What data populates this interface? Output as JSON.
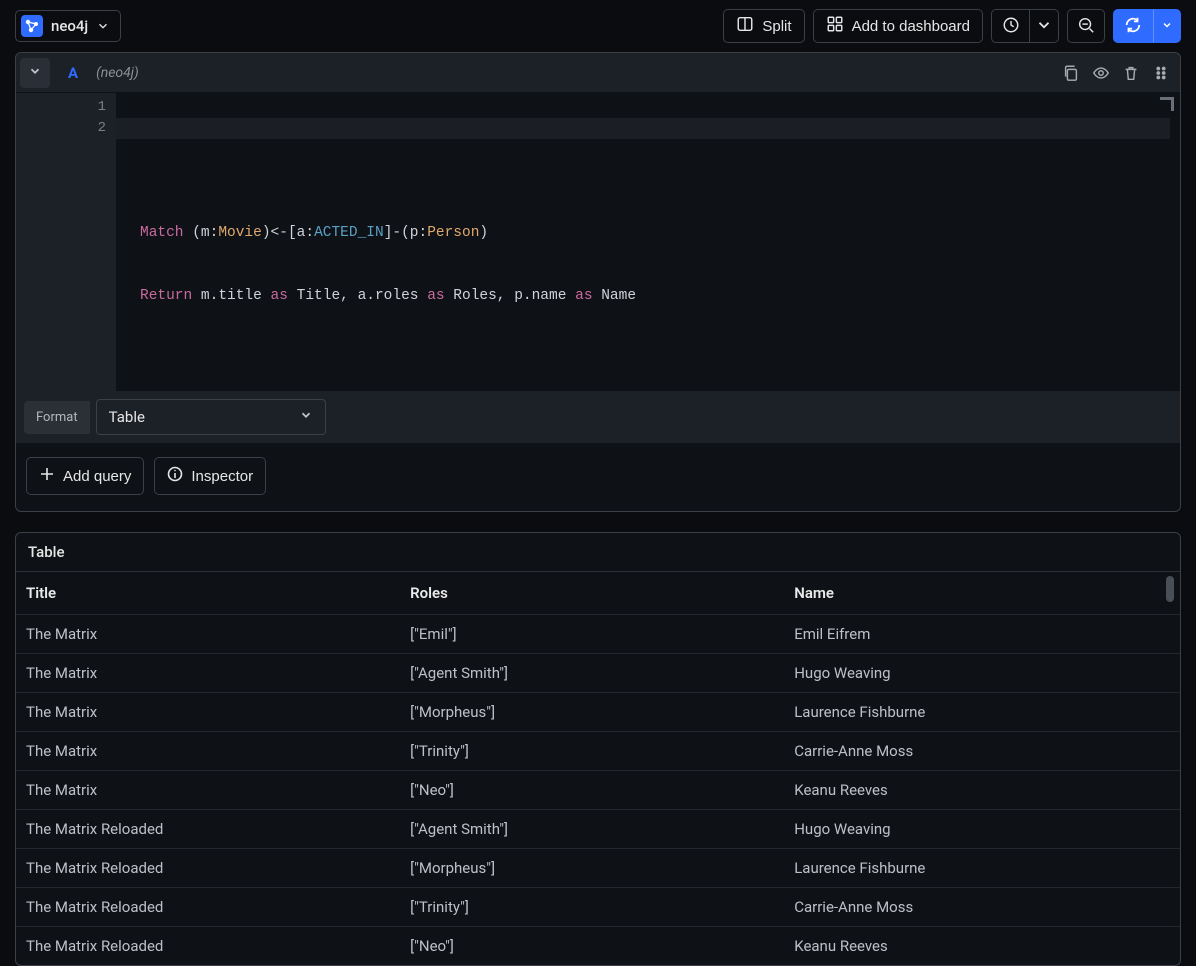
{
  "db": {
    "name": "neo4j",
    "icon": "neo4j-logo"
  },
  "toolbar": {
    "split_label": "Split",
    "dashboard_label": "Add to dashboard"
  },
  "query": {
    "letter": "A",
    "context": "(neo4j)",
    "line_numbers": [
      "1",
      "2"
    ],
    "tokens_line1": [
      {
        "t": "Match ",
        "c": "tok-kw"
      },
      {
        "t": "(",
        "c": "tok-punct"
      },
      {
        "t": "m",
        "c": "tok-var"
      },
      {
        "t": ":",
        "c": "tok-punct"
      },
      {
        "t": "Movie",
        "c": "tok-label"
      },
      {
        "t": ")<-[",
        "c": "tok-punct"
      },
      {
        "t": "a",
        "c": "tok-var"
      },
      {
        "t": ":",
        "c": "tok-punct"
      },
      {
        "t": "ACTED_IN",
        "c": "tok-rel"
      },
      {
        "t": "]-(",
        "c": "tok-punct"
      },
      {
        "t": "p",
        "c": "tok-var"
      },
      {
        "t": ":",
        "c": "tok-punct"
      },
      {
        "t": "Person",
        "c": "tok-label"
      },
      {
        "t": ")",
        "c": "tok-punct"
      }
    ],
    "tokens_line2": [
      {
        "t": "Return ",
        "c": "tok-kw"
      },
      {
        "t": "m.title ",
        "c": "tok-var"
      },
      {
        "t": "as ",
        "c": "tok-kw"
      },
      {
        "t": "Title, a.roles ",
        "c": "tok-var"
      },
      {
        "t": "as ",
        "c": "tok-kw"
      },
      {
        "t": "Roles, p.name ",
        "c": "tok-var"
      },
      {
        "t": "as ",
        "c": "tok-kw"
      },
      {
        "t": "Name",
        "c": "tok-var"
      }
    ],
    "format_label": "Format",
    "format_value": "Table"
  },
  "actions": {
    "add_query": "Add query",
    "inspector": "Inspector"
  },
  "results": {
    "title": "Table",
    "columns": [
      "Title",
      "Roles",
      "Name"
    ],
    "rows": [
      [
        "The Matrix",
        "[\"Emil\"]",
        "Emil Eifrem"
      ],
      [
        "The Matrix",
        "[\"Agent Smith\"]",
        "Hugo Weaving"
      ],
      [
        "The Matrix",
        "[\"Morpheus\"]",
        "Laurence Fishburne"
      ],
      [
        "The Matrix",
        "[\"Trinity\"]",
        "Carrie-Anne Moss"
      ],
      [
        "The Matrix",
        "[\"Neo\"]",
        "Keanu Reeves"
      ],
      [
        "The Matrix Reloaded",
        "[\"Agent Smith\"]",
        "Hugo Weaving"
      ],
      [
        "The Matrix Reloaded",
        "[\"Morpheus\"]",
        "Laurence Fishburne"
      ],
      [
        "The Matrix Reloaded",
        "[\"Trinity\"]",
        "Carrie-Anne Moss"
      ],
      [
        "The Matrix Reloaded",
        "[\"Neo\"]",
        "Keanu Reeves"
      ]
    ]
  }
}
